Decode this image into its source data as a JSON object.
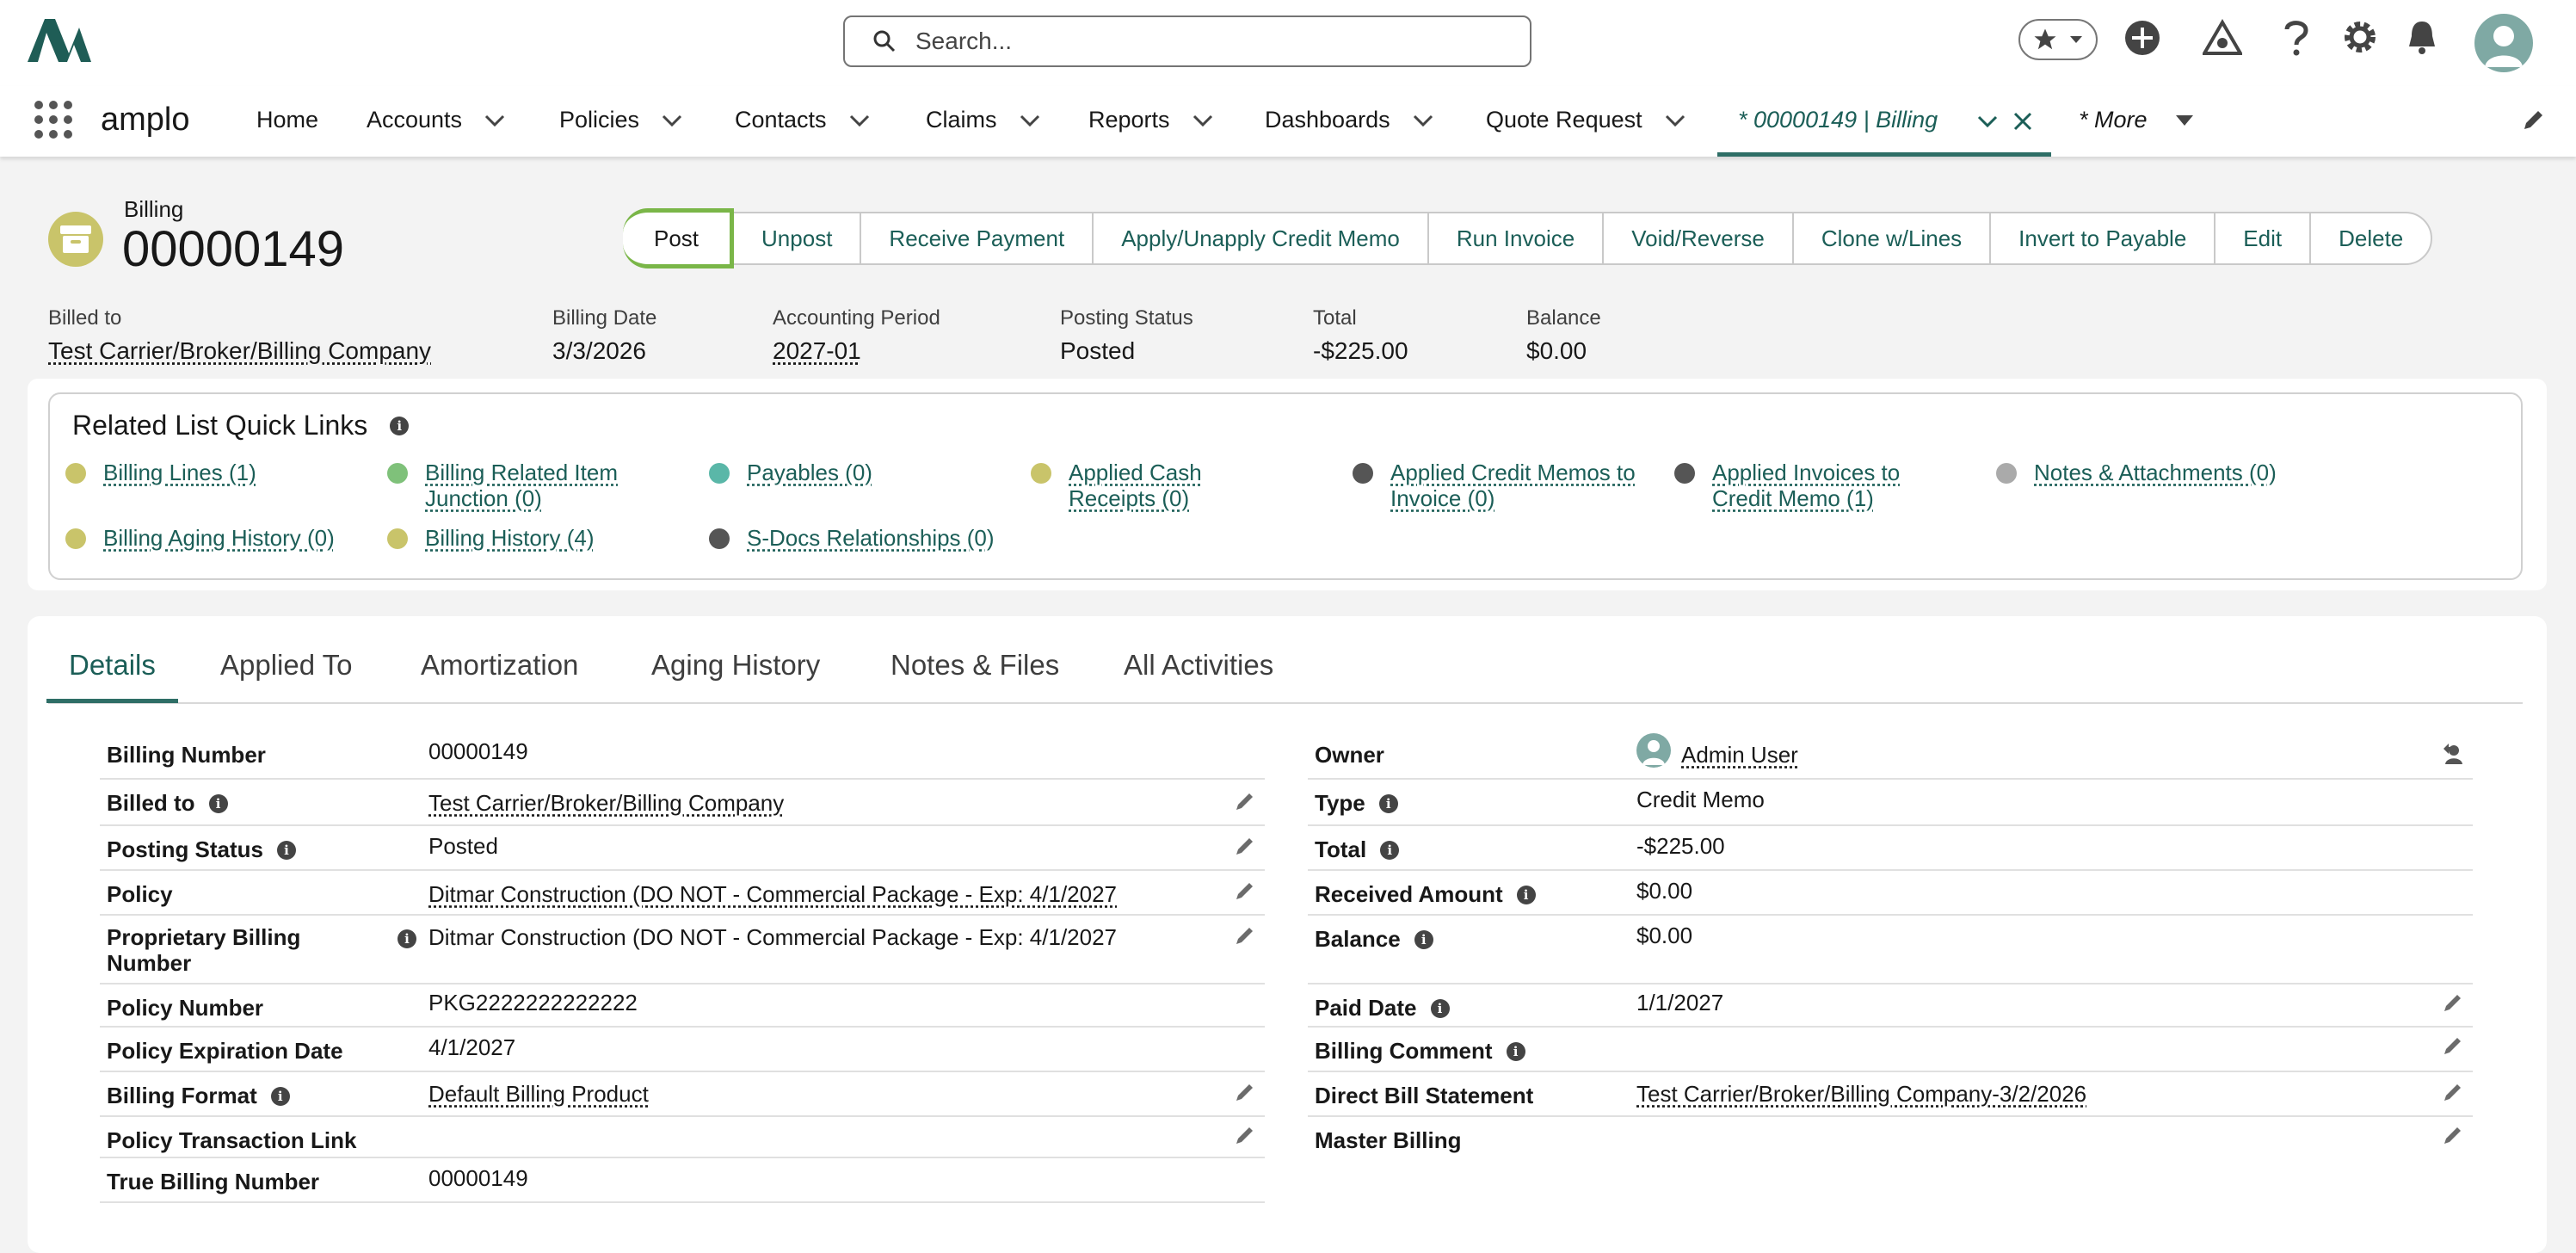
{
  "header": {
    "search_placeholder": "Search...",
    "app_name": "amplo"
  },
  "nav": {
    "items": [
      {
        "label": "Home"
      },
      {
        "label": "Accounts"
      },
      {
        "label": "Policies"
      },
      {
        "label": "Contacts"
      },
      {
        "label": "Claims"
      },
      {
        "label": "Reports"
      },
      {
        "label": "Dashboards"
      },
      {
        "label": "Quote Request"
      }
    ],
    "active_tab": "* 00000149 | Billing",
    "more": "* More"
  },
  "record": {
    "type": "Billing",
    "title": "00000149",
    "actions": [
      "Post",
      "Unpost",
      "Receive Payment",
      "Apply/Unapply Credit Memo",
      "Run Invoice",
      "Void/Reverse",
      "Clone w/Lines",
      "Invert to Payable",
      "Edit",
      "Delete"
    ],
    "highlights": [
      {
        "label": "Billed to",
        "value": "Test Carrier/Broker/Billing Company"
      },
      {
        "label": "Billing Date",
        "value": "3/3/2026"
      },
      {
        "label": "Accounting Period",
        "value": "2027-01"
      },
      {
        "label": "Posting Status",
        "value": "Posted"
      },
      {
        "label": "Total",
        "value": "-$225.00"
      },
      {
        "label": "Balance",
        "value": "$0.00"
      }
    ]
  },
  "quick_links": {
    "title": "Related List Quick Links",
    "links": [
      {
        "line1": "Billing Lines (1)",
        "line2": ""
      },
      {
        "line1": "Billing Related Item",
        "line2": "Junction (0)"
      },
      {
        "line1": "Payables (0)",
        "line2": ""
      },
      {
        "line1": "Applied Cash",
        "line2": "Receipts (0)"
      },
      {
        "line1": "Applied Credit Memos to",
        "line2": "Invoice (0)"
      },
      {
        "line1": "Applied Invoices to",
        "line2": "Credit Memo (1)"
      },
      {
        "line1": "Notes & Attachments (0)",
        "line2": ""
      },
      {
        "line1": "Billing Aging History (0)",
        "line2": ""
      },
      {
        "line1": "Billing History (4)",
        "line2": ""
      },
      {
        "line1": "S-Docs Relationships (0)",
        "line2": ""
      }
    ]
  },
  "tabs": [
    "Details",
    "Applied To",
    "Amortization",
    "Aging History",
    "Notes & Files",
    "All Activities"
  ],
  "details": {
    "left": [
      {
        "label": "Billing Number",
        "value": "00000149"
      },
      {
        "label": "Billed to",
        "value": "Test Carrier/Broker/Billing Company"
      },
      {
        "label": "Posting Status",
        "value": "Posted"
      },
      {
        "label": "Policy",
        "value": "Ditmar Construction (DO NOT - Commercial Package - Exp: 4/1/2027"
      },
      {
        "label": "Proprietary Billing",
        "label2": "Number",
        "value": "Ditmar Construction (DO NOT - Commercial Package - Exp: 4/1/2027"
      },
      {
        "label": "Policy Number",
        "value": "PKG2222222222222"
      },
      {
        "label": "Policy Expiration Date",
        "value": "4/1/2027"
      },
      {
        "label": "Billing Format",
        "value": "Default Billing Product"
      },
      {
        "label": "Policy Transaction Link",
        "value": ""
      },
      {
        "label": "True Billing Number",
        "value": "00000149"
      }
    ],
    "right": [
      {
        "label": "Owner",
        "value": "Admin User"
      },
      {
        "label": "Type",
        "value": "Credit Memo"
      },
      {
        "label": "Total",
        "value": "-$225.00"
      },
      {
        "label": "Received Amount",
        "value": "$0.00"
      },
      {
        "label": "Balance",
        "value": "$0.00"
      },
      {
        "label": "Paid Date",
        "value": "1/1/2027"
      },
      {
        "label": "Billing Comment",
        "value": ""
      },
      {
        "label": "Direct Bill Statement",
        "value": "Test Carrier/Broker/Billing Company-3/2/2026"
      },
      {
        "label": "Master Billing",
        "value": ""
      }
    ]
  },
  "colors": {
    "accent": "#1b5e57",
    "post_highlight": "#7ab648",
    "record_icon": "#c9c46a"
  }
}
